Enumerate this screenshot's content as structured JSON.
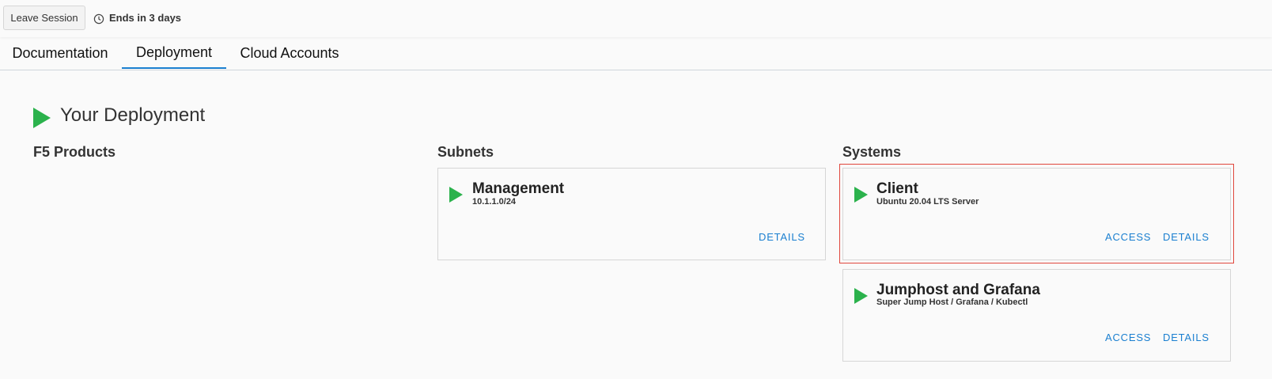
{
  "topbar": {
    "leave_label": "Leave Session",
    "ends_label": "Ends in 3 days",
    "clock_icon": "clock-icon"
  },
  "tabs": [
    {
      "label": "Documentation",
      "active": false
    },
    {
      "label": "Deployment",
      "active": true
    },
    {
      "label": "Cloud Accounts",
      "active": false
    }
  ],
  "deployment": {
    "title": "Your Deployment",
    "status_icon": "play-triangle-icon"
  },
  "sections": {
    "products": "F5 Products",
    "subnets": "Subnets",
    "systems": "Systems"
  },
  "subnets": [
    {
      "name": "Management",
      "cidr": "10.1.1.0/24",
      "details_label": "DETAILS"
    }
  ],
  "systems": [
    {
      "name": "Client",
      "desc": "Ubuntu 20.04 LTS Server",
      "access_label": "ACCESS",
      "details_label": "DETAILS",
      "highlighted": true
    },
    {
      "name": "Jumphost and Grafana",
      "desc": "Super Jump Host / Grafana / Kubectl",
      "access_label": "ACCESS",
      "details_label": "DETAILS",
      "highlighted": false
    }
  ],
  "colors": {
    "accent": "#1a7fd0",
    "status_green": "#2bb24c",
    "highlight_red": "#e0463c"
  }
}
